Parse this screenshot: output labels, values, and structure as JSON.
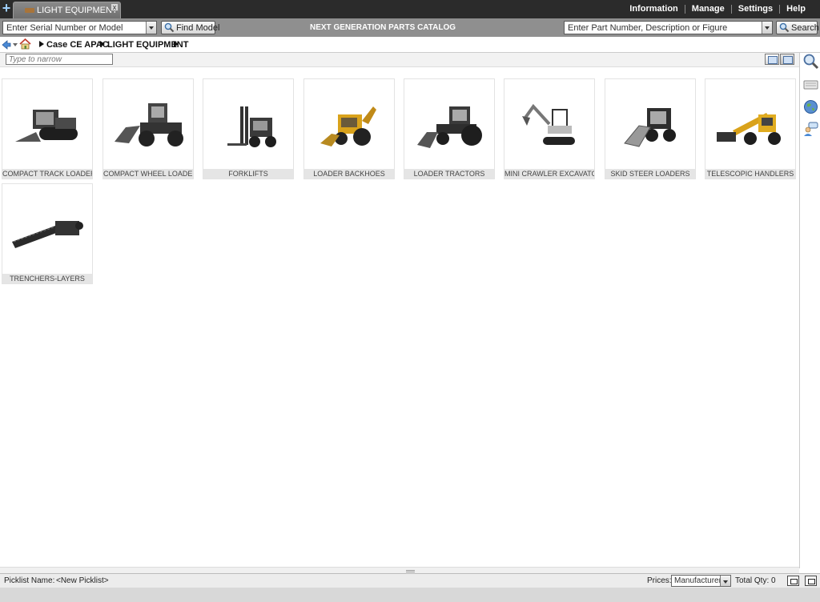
{
  "tabs": [
    {
      "label": "LIGHT EQUIPMENT",
      "close": "x"
    }
  ],
  "top_nav": [
    "Information",
    "Manage",
    "Settings",
    "Help"
  ],
  "serial_combo": {
    "value": "Enter Serial Number or Model"
  },
  "find_model_label": "Find Model",
  "catalog_title": "NEXT GENERATION PARTS CATALOG",
  "part_combo": {
    "value": "Enter Part Number, Description or Figure"
  },
  "search_label": "Search",
  "breadcrumb": [
    "Case CE APAC",
    "LIGHT EQUIPMENT"
  ],
  "narrow_placeholder": "Type to narrow",
  "categories": [
    {
      "label": "COMPACT TRACK LOADERS",
      "icon": "compact-track-loader-icon"
    },
    {
      "label": "COMPACT WHEEL LOADERS",
      "icon": "compact-wheel-loader-icon"
    },
    {
      "label": "FORKLIFTS",
      "icon": "forklift-icon"
    },
    {
      "label": "LOADER BACKHOES",
      "icon": "loader-backhoe-icon"
    },
    {
      "label": "LOADER TRACTORS",
      "icon": "loader-tractor-icon"
    },
    {
      "label": "MINI CRAWLER EXCAVATOR",
      "icon": "mini-excavator-icon"
    },
    {
      "label": "SKID STEER LOADERS",
      "icon": "skid-steer-loader-icon"
    },
    {
      "label": "TELESCOPIC HANDLERS",
      "icon": "telescopic-handler-icon"
    },
    {
      "label": "TRENCHERS-LAYERS",
      "icon": "trencher-icon"
    }
  ],
  "status": {
    "picklist_label": "Picklist Name:",
    "picklist_value": "<New Picklist>",
    "prices_label": "Prices:",
    "prices_value": "Manufacturer",
    "total_qty": "Total Qty: 0"
  },
  "colors": {
    "topbar": "#2b2b2b",
    "toolbar": "#8f8f8f",
    "machine_yellow": "#d9a21b",
    "machine_dark": "#333333"
  }
}
